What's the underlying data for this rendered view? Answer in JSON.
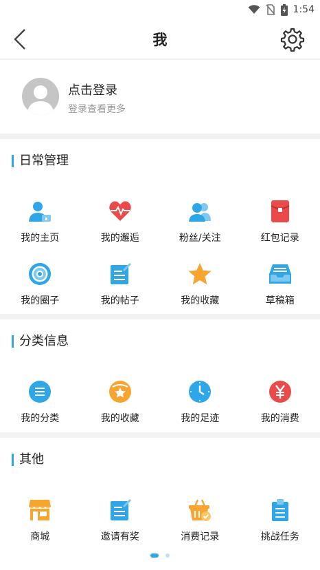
{
  "status_bar": {
    "time": "1:54"
  },
  "header": {
    "title": "我"
  },
  "login": {
    "title": "点击登录",
    "subtitle": "登录查看更多"
  },
  "daily": {
    "title": "日常管理",
    "items": [
      {
        "label": "我的主页",
        "icon": "user-home-icon"
      },
      {
        "label": "我的邂逅",
        "icon": "heart-pulse-icon"
      },
      {
        "label": "粉丝/关注",
        "icon": "users-icon"
      },
      {
        "label": "红包记录",
        "icon": "red-envelope-icon"
      },
      {
        "label": "我的圈子",
        "icon": "circle-target-icon"
      },
      {
        "label": "我的帖子",
        "icon": "post-edit-icon"
      },
      {
        "label": "我的收藏",
        "icon": "star-icon"
      },
      {
        "label": "草稿箱",
        "icon": "inbox-tray-icon"
      }
    ]
  },
  "category": {
    "title": "分类信息",
    "items": [
      {
        "label": "我的分类",
        "icon": "list-icon"
      },
      {
        "label": "我的收藏",
        "icon": "folder-star-icon"
      },
      {
        "label": "我的足迹",
        "icon": "clock-icon"
      },
      {
        "label": "我的消费",
        "icon": "yuan-icon"
      }
    ]
  },
  "other": {
    "title": "其他",
    "items": [
      {
        "label": "商城",
        "icon": "shop-icon"
      },
      {
        "label": "邀请有奖",
        "icon": "invite-edit-icon"
      },
      {
        "label": "消费记录",
        "icon": "basket-check-icon"
      },
      {
        "label": "挑战任务",
        "icon": "clipboard-icon"
      }
    ]
  },
  "colors": {
    "accent": "#2ea6e8",
    "red": "#ea4a4a",
    "orange": "#f7a531"
  }
}
